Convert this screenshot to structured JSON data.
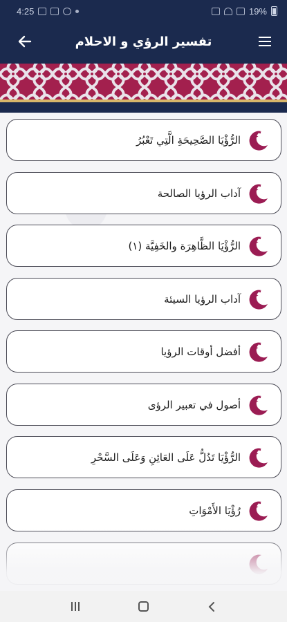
{
  "status_bar": {
    "time": "4:25",
    "battery": "19%"
  },
  "app_bar": {
    "title": "تفسير الرؤي و الاحلام",
    "back_icon": "arrow-left-icon",
    "menu_icon": "hamburger-menu-icon"
  },
  "colors": {
    "primary": "#1b2a4e",
    "banner": "#a3204e",
    "moon": "#9b1c53"
  },
  "items": [
    {
      "label": "الرُّؤْيَا الصَّحِيحَةِ الَّتِي تَعْبُرُ",
      "icon": "crescent-moon-icon"
    },
    {
      "label": "آداب الرؤيا الصالحة",
      "icon": "crescent-moon-icon"
    },
    {
      "label": "الرُّؤْيَا الظَّاهِرَة والخَفِيَّة (١)",
      "icon": "crescent-moon-icon"
    },
    {
      "label": "آداب الرؤيا السيئة",
      "icon": "crescent-moon-icon"
    },
    {
      "label": "أفضل أوقات الرؤيا",
      "icon": "crescent-moon-icon"
    },
    {
      "label": "أصول في تعبير الرؤى",
      "icon": "crescent-moon-icon"
    },
    {
      "label": "الرُّؤْيَا تَدُلُّ عَلَى العَائِنِ وَعَلَى السَّحْرِ",
      "icon": "crescent-moon-icon"
    },
    {
      "label": "رُؤْيَا الأَمْوَاتِ",
      "icon": "crescent-moon-icon"
    },
    {
      "label": "",
      "icon": "crescent-moon-icon"
    }
  ]
}
